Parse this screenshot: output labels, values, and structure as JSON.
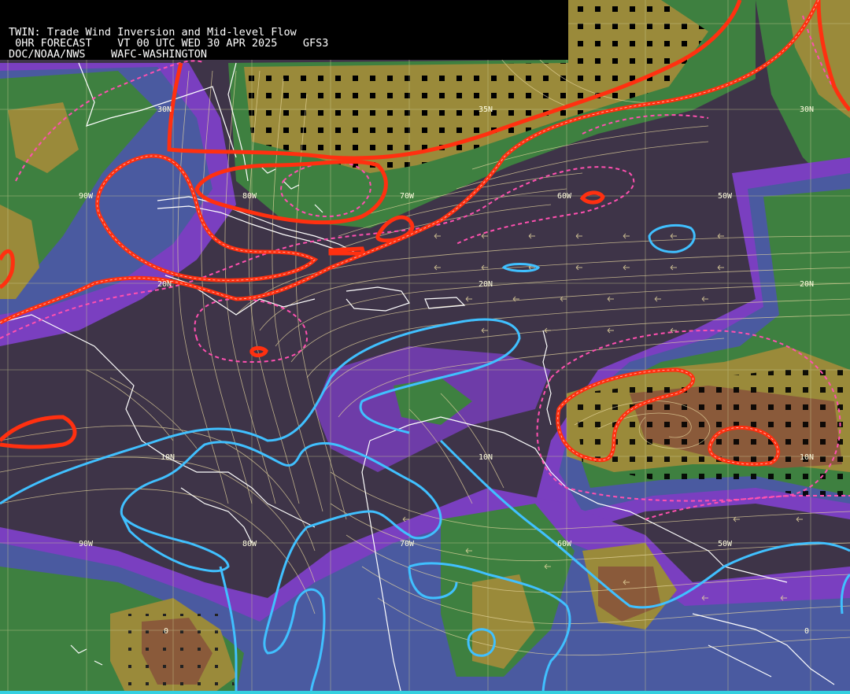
{
  "header": {
    "line1": "TWIN: Trade Wind Inversion and Mid-level Flow",
    "line2": " 0HR FORECAST    VT 00 UTC WED 30 APR 2025    GFS3",
    "line3": "DOC/NOAA/NWS    WAFC-WASHINGTON"
  },
  "grid_labels": {
    "lat_30n_a": "30N",
    "lat_30n_b": "35N",
    "lat_30n_c": "30N",
    "lat_20n_a": "20N",
    "lat_20n_b": "20N",
    "lat_20n_c": "20N",
    "lat_10n_a": "10N",
    "lat_10n_b": "10N",
    "lat_10n_c": "10N",
    "lon_90w_a": "90W",
    "lon_80w_a": "80W",
    "lon_70w_a": "70W",
    "lon_60w_a": "60W",
    "lon_50w_a": "50W",
    "lon_90w_b": "90W",
    "lon_80w_b": "80W",
    "lon_70w_b": "70W",
    "lon_60w_b": "60W",
    "lon_50w_b": "50W",
    "eq_a": "0",
    "eq_b": "0"
  },
  "colors": {
    "background": "#3e3448",
    "purple_band": "#7a3fc0",
    "blue_band": "#4a5aa0",
    "green_band": "#3e8040",
    "green_light": "#5e9a3a",
    "olive": "#9a8a3a",
    "brown": "#8a5a3a",
    "inversion_red": "#ff3010",
    "dashed_pink": "#ff50b0",
    "cyan_contour": "#40c0ff",
    "streamline": "#e8d8a0",
    "coastline": "#ffffff",
    "grid": "#c8c890"
  }
}
